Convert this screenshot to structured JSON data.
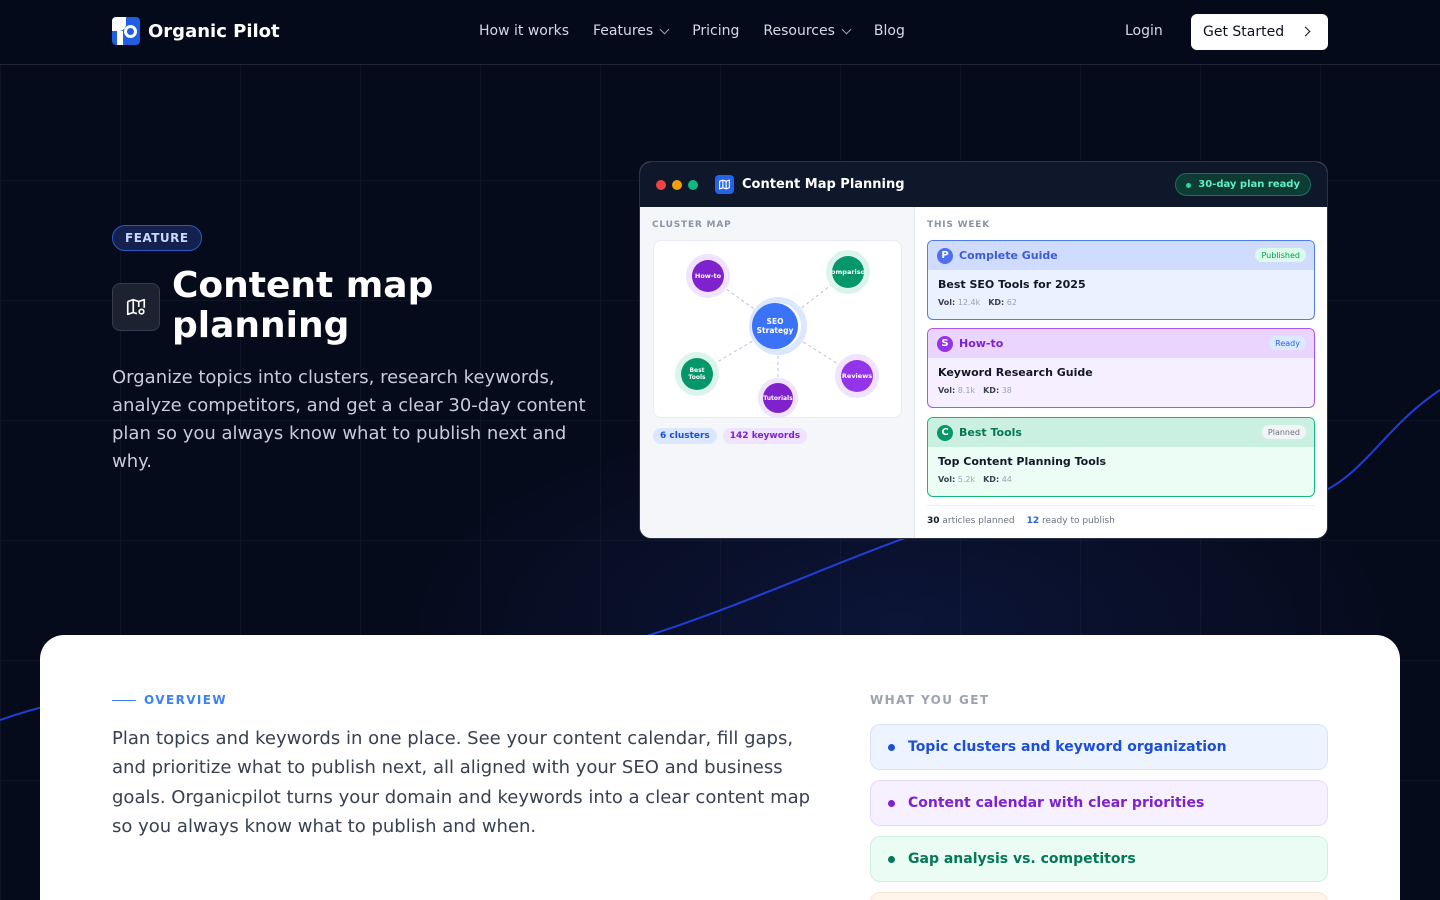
{
  "nav": {
    "brand": "Organic Pilot",
    "items": [
      {
        "label": "How it works",
        "dropdown": false
      },
      {
        "label": "Features",
        "dropdown": true
      },
      {
        "label": "Pricing",
        "dropdown": false
      },
      {
        "label": "Resources",
        "dropdown": true
      },
      {
        "label": "Blog",
        "dropdown": false
      }
    ],
    "login": "Login",
    "cta": "Get Started"
  },
  "hero": {
    "badge": "FEATURE",
    "icon": "map-pin-icon",
    "title": "Content map planning",
    "description": "Organize topics into clusters, research keywords, analyze competitors, and get a clear 30-day content plan so you always know what to publish next and why."
  },
  "app": {
    "title": "Content Map Planning",
    "status_pill": "30-day plan ready",
    "cluster_label": "CLUSTER MAP",
    "center_node": "SEO Strategy",
    "nodes": [
      "How-to",
      "Comparison",
      "Best Tools",
      "Reviews",
      "Tutorials"
    ],
    "chips": [
      "6 clusters",
      "142 keywords"
    ],
    "week_label": "THIS WEEK",
    "tasks": [
      {
        "letter": "P",
        "category": "Complete Guide",
        "status": "Published",
        "name": "Best SEO Tools for 2025",
        "vol_label": "Vol:",
        "vol": "12.4k",
        "kd_label": "KD:",
        "kd": "62"
      },
      {
        "letter": "S",
        "category": "How-to",
        "status": "Ready",
        "name": "Keyword Research Guide",
        "vol_label": "Vol:",
        "vol": "8.1k",
        "kd_label": "KD:",
        "kd": "38"
      },
      {
        "letter": "C",
        "category": "Best Tools",
        "status": "Planned",
        "name": "Top Content Planning Tools",
        "vol_label": "Vol:",
        "vol": "5.2k",
        "kd_label": "KD:",
        "kd": "44"
      }
    ],
    "footer": {
      "planned_count": "30",
      "planned_text": "articles planned",
      "ready_count": "12",
      "ready_text": "ready to publish"
    }
  },
  "overview": {
    "label": "OVERVIEW",
    "text": "Plan topics and keywords in one place. See your content calendar, fill gaps, and prioritize what to publish next, all aligned with your SEO and business goals. Organicpilot turns your domain and keywords into a clear content map so you always know what to publish and when.",
    "what_you_get_label": "WHAT YOU GET",
    "benefits": [
      "Topic clusters and keyword organization",
      "Content calendar with clear priorities",
      "Gap analysis vs. competitors"
    ]
  },
  "colors": {
    "background": "#060b1c",
    "accent_blue": "#2563eb",
    "purple": "#7c3aed",
    "green": "#059669"
  }
}
